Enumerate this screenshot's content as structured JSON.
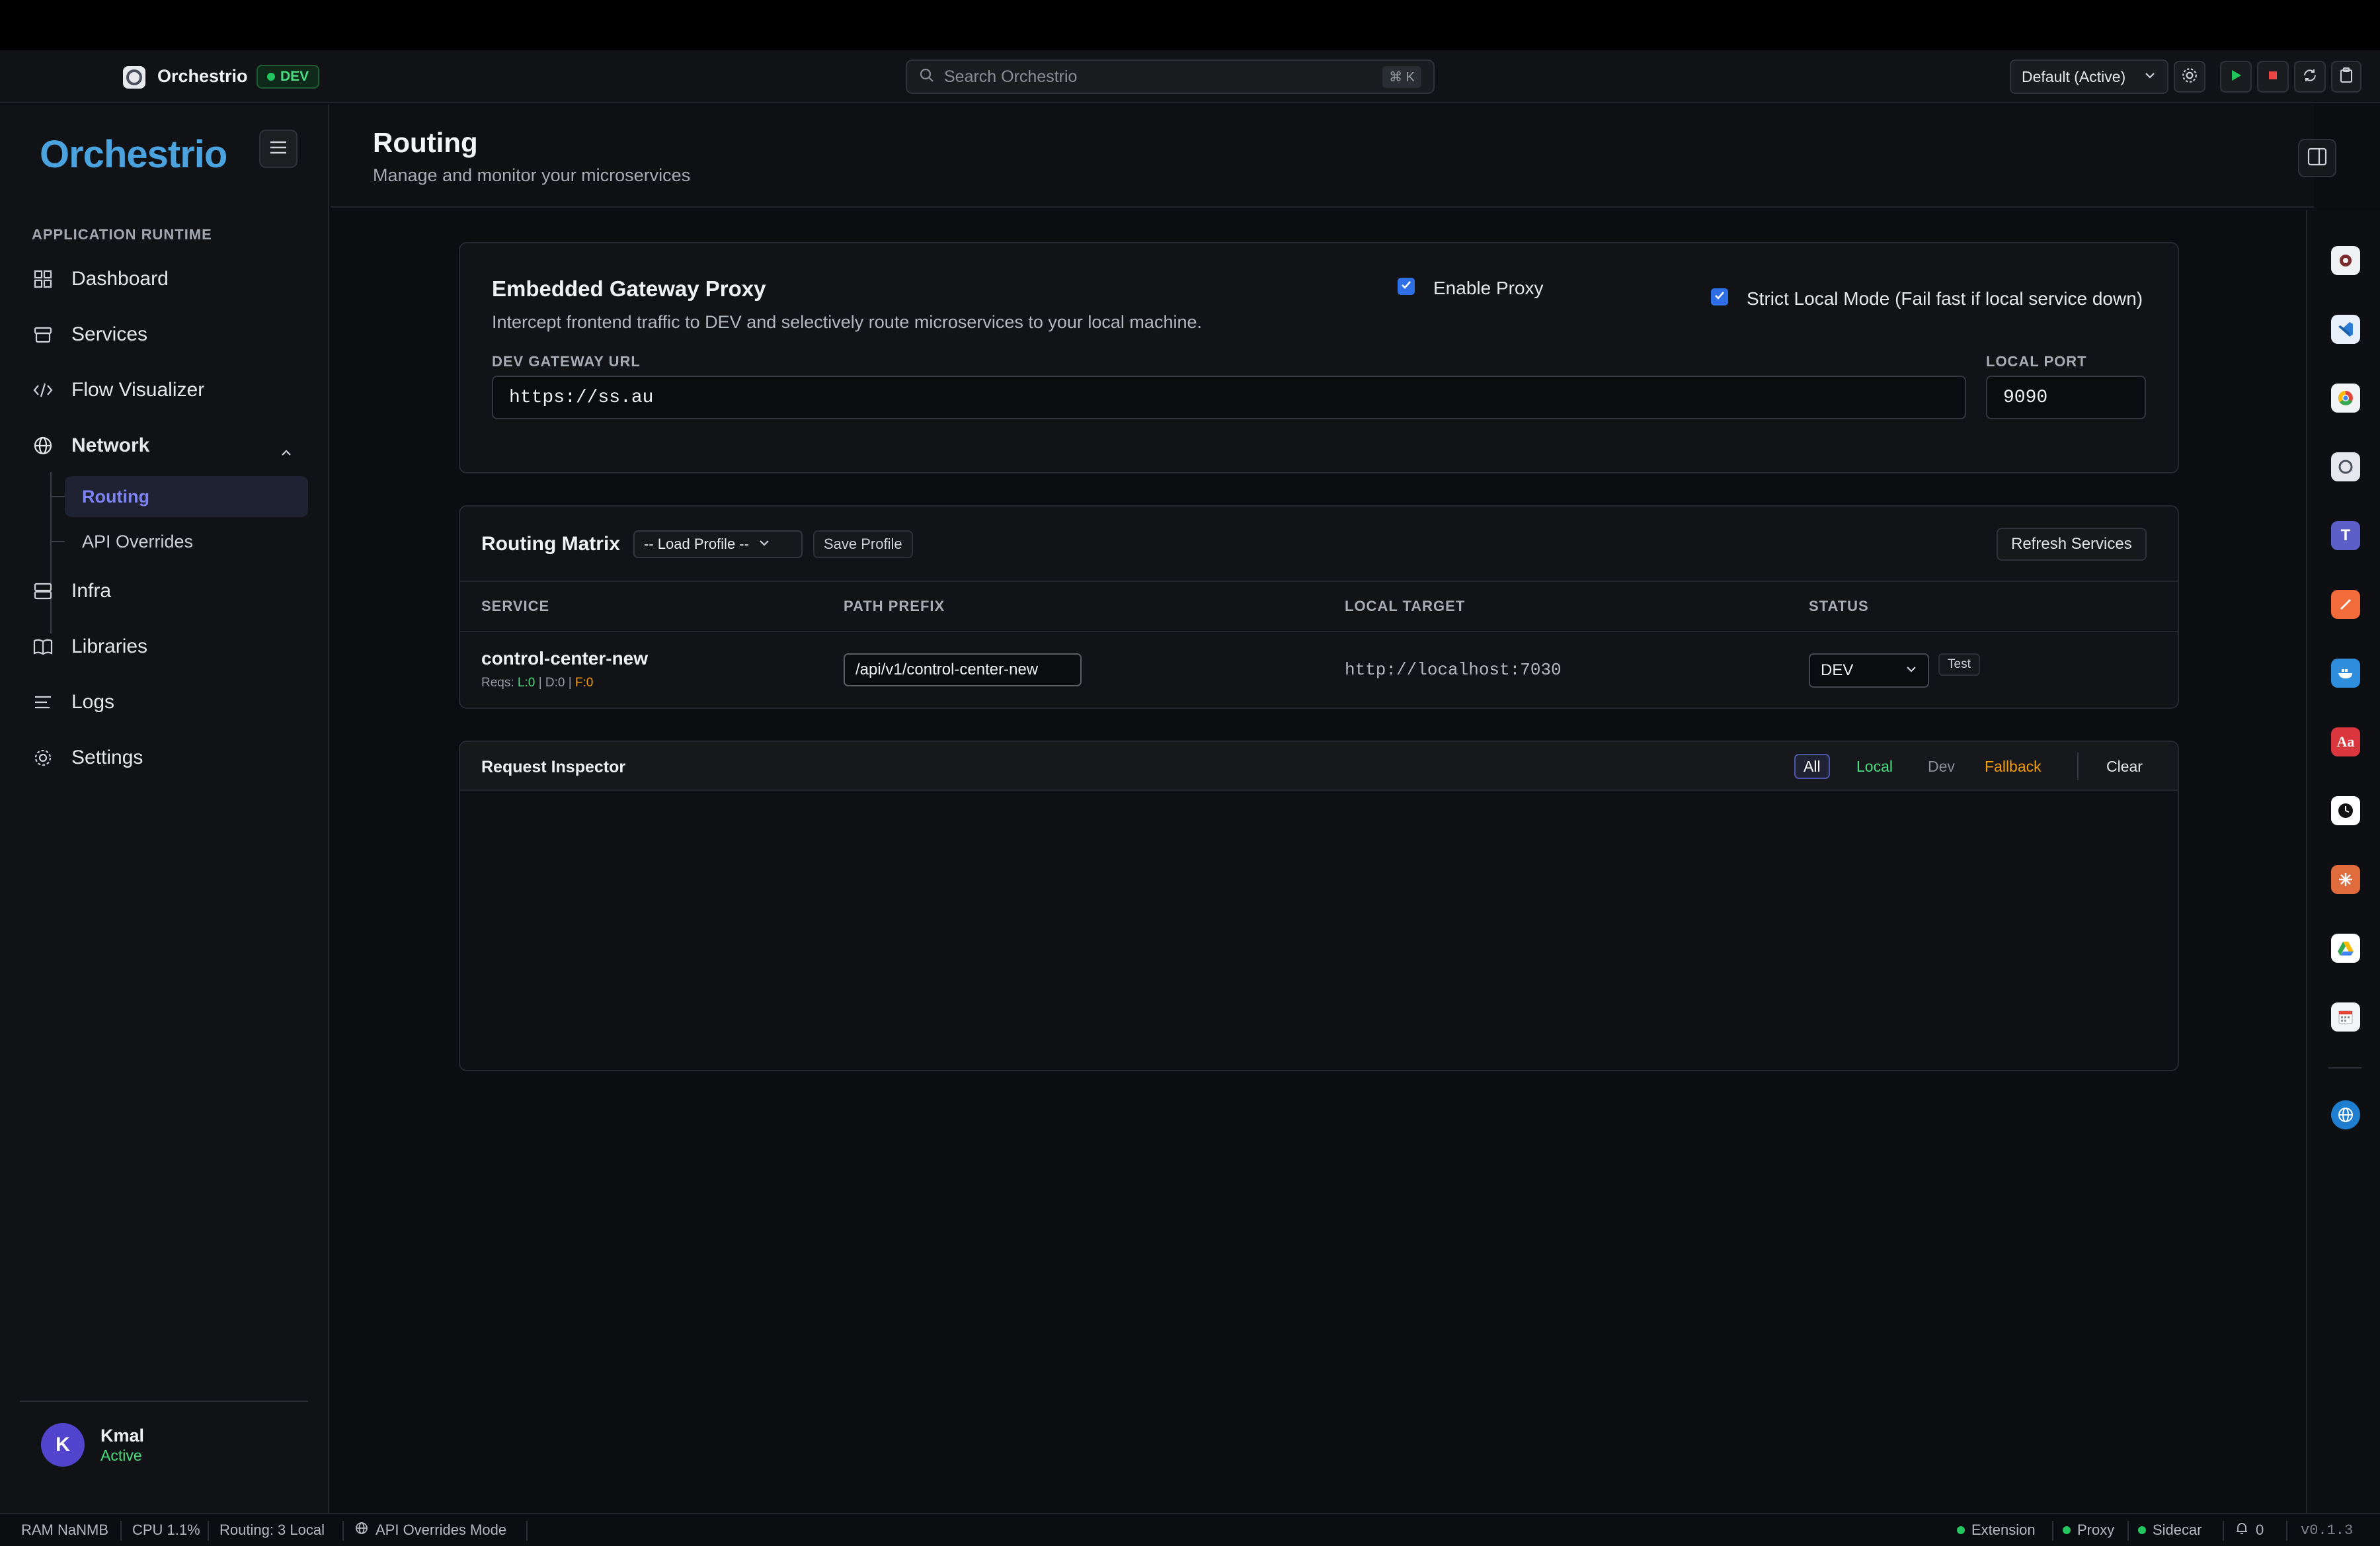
{
  "titlebar": {
    "app_name": "Orchestrio",
    "env_badge": "DEV",
    "search_placeholder": "Search Orchestrio",
    "search_shortcut": "⌘ K",
    "profile_select": "Default (Active)"
  },
  "sidebar": {
    "logo": "Orchestrio",
    "section": "APPLICATION RUNTIME",
    "items": [
      {
        "label": "Dashboard",
        "icon": "grid-icon"
      },
      {
        "label": "Services",
        "icon": "box-icon"
      },
      {
        "label": "Flow Visualizer",
        "icon": "code-icon"
      },
      {
        "label": "Network",
        "icon": "globe-icon"
      },
      {
        "label": "Infra",
        "icon": "server-icon"
      },
      {
        "label": "Libraries",
        "icon": "book-icon"
      },
      {
        "label": "Logs",
        "icon": "list-icon"
      },
      {
        "label": "Settings",
        "icon": "gear-icon"
      }
    ],
    "sub_items": [
      {
        "label": "Routing",
        "active": true
      },
      {
        "label": "API Overrides",
        "active": false
      }
    ],
    "user": {
      "initial": "K",
      "name": "Kmal",
      "status": "Active"
    }
  },
  "header": {
    "title": "Routing",
    "subtitle": "Manage and monitor your microservices"
  },
  "gateway": {
    "title": "Embedded Gateway Proxy",
    "description": "Intercept frontend traffic to DEV and selectively route microservices to your local machine.",
    "enable_proxy_label": "Enable Proxy",
    "enable_proxy_checked": true,
    "strict_mode_label": "Strict Local Mode (Fail fast if local service down)",
    "strict_mode_checked": true,
    "gateway_url_label": "DEV GATEWAY URL",
    "gateway_url_value": "https://ss.au",
    "local_port_label": "LOCAL PORT",
    "local_port_value": "9090"
  },
  "matrix": {
    "title": "Routing Matrix",
    "load_profile": "-- Load Profile --",
    "save_profile": "Save Profile",
    "refresh": "Refresh Services",
    "columns": [
      "SERVICE",
      "PATH PREFIX",
      "LOCAL TARGET",
      "STATUS"
    ],
    "rows": [
      {
        "service": "control-center-new",
        "reqs_label": "Reqs:",
        "l": "L:0",
        "d": "D:0",
        "f": "F:0",
        "path_prefix": "/api/v1/control-center-new",
        "local_target": "http://localhost:7030",
        "status": "DEV",
        "test_label": "Test"
      }
    ]
  },
  "inspector": {
    "title": "Request Inspector",
    "filters": [
      "All",
      "Local",
      "Dev",
      "Fallback"
    ],
    "active_filter": "All",
    "clear": "Clear"
  },
  "statusbar": {
    "ram": "RAM NaNMB",
    "cpu": "CPU 1.1%",
    "routing": "Routing: 3 Local",
    "api_mode": "API Overrides Mode",
    "extension": "Extension",
    "proxy": "Proxy",
    "sidecar": "Sidecar",
    "notifications": "0",
    "version": "v0.1.3"
  },
  "colors": {
    "accent": "#4aa3df",
    "active_nav": "#7c84f5",
    "green": "#22c55e",
    "amber": "#f59e0b",
    "checkbox": "#2f6fe6"
  }
}
